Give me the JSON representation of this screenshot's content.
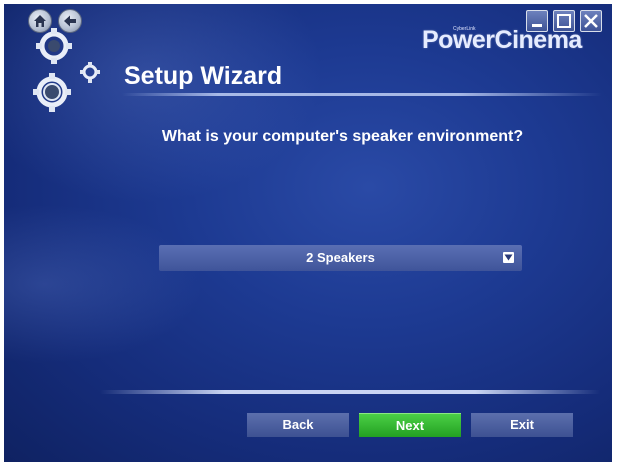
{
  "app": {
    "brand_small": "CyberLink",
    "brand": "PowerCinema"
  },
  "header": {
    "title": "Setup Wizard"
  },
  "main": {
    "question": "What is your computer's speaker environment?",
    "speaker_select": {
      "value": "2 Speakers"
    }
  },
  "footer": {
    "back_label": "Back",
    "next_label": "Next",
    "exit_label": "Exit"
  },
  "colors": {
    "background": "#1d3a92",
    "next_button": "#2db52b",
    "button": "#4a5ea0"
  },
  "icons": [
    "home-icon",
    "back-arrow-icon",
    "gears-icon",
    "minimize-icon",
    "maximize-icon",
    "close-icon",
    "dropdown-arrow-icon"
  ]
}
